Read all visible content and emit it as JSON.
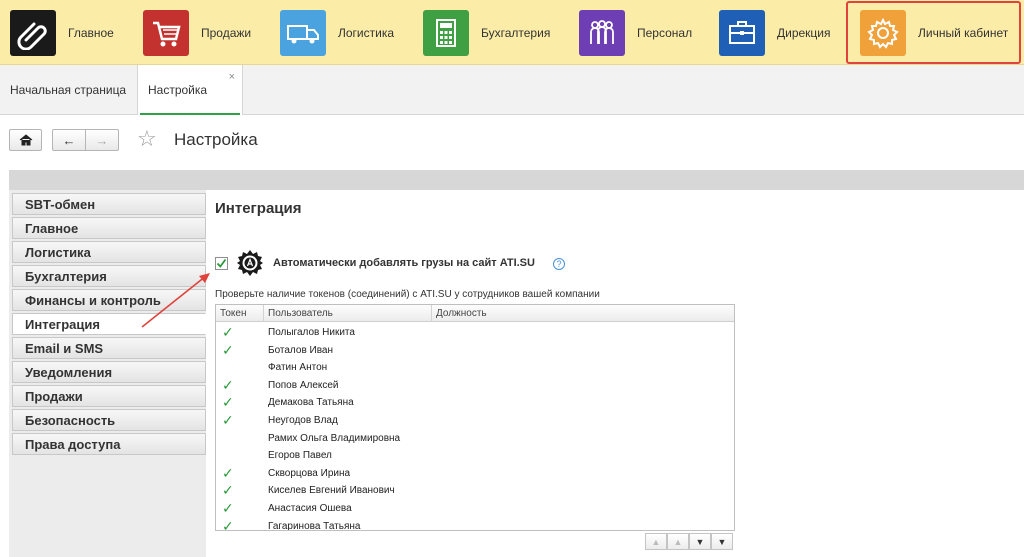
{
  "sections": [
    {
      "label": "Главное",
      "icon": "paperclip-icon",
      "color": "#1a1a1a"
    },
    {
      "label": "Продажи",
      "icon": "shopping-cart-icon",
      "color": "#c3322f"
    },
    {
      "label": "Логистика",
      "icon": "truck-icon",
      "color": "#4aa3df"
    },
    {
      "label": "Бухгалтерия",
      "icon": "calculator-icon",
      "color": "#3ea042"
    },
    {
      "label": "Персонал",
      "icon": "people-icon",
      "color": "#6e3fb4"
    },
    {
      "label": "Дирекция",
      "icon": "briefcase-icon",
      "color": "#1f5fb5"
    },
    {
      "label": "Личный кабинет",
      "icon": "gear-icon",
      "color": "#f0a13a"
    }
  ],
  "tabs": {
    "home": "Начальная страница",
    "current": "Настройка",
    "close": "×"
  },
  "page_title": "Настройка",
  "menu": [
    "SBT-обмен",
    "Главное",
    "Логистика",
    "Бухгалтерия",
    "Финансы и контроль",
    "Интеграция",
    "Email и SMS",
    "Уведомления",
    "Продажи",
    "Безопасность",
    "Права доступа"
  ],
  "active_menu": "Интеграция",
  "content": {
    "title": "Интеграция",
    "checkbox_label": "Автоматически добавлять грузы на сайт ATI.SU",
    "checkbox_checked": true,
    "help": "?",
    "hint": "Проверьте наличие токенов (соединений) с ATI.SU у сотрудников вашей компании"
  },
  "table": {
    "headers": [
      "Токен",
      "Пользователь",
      "Должность"
    ],
    "rows": [
      {
        "token": true,
        "user": "Полыгалов Никита"
      },
      {
        "token": true,
        "user": "Боталов Иван"
      },
      {
        "token": false,
        "user": "Фатин Антон"
      },
      {
        "token": true,
        "user": "Попов Алексей"
      },
      {
        "token": true,
        "user": "Демакова Татьяна"
      },
      {
        "token": true,
        "user": "Неугодов Влад"
      },
      {
        "token": false,
        "user": "Рамих Ольга Владимировна"
      },
      {
        "token": false,
        "user": "Егоров Павел"
      },
      {
        "token": true,
        "user": "Скворцова Ирина"
      },
      {
        "token": true,
        "user": "Киселев Евгений Иванович"
      },
      {
        "token": true,
        "user": "Анастасия Ошева"
      },
      {
        "token": true,
        "user": "Гагаринова Татьяна"
      }
    ]
  },
  "colors": {
    "topbar": "#fbeda8",
    "active_outline": "#e0423c",
    "tab_accent": "#2fa14a",
    "check": "#2b9a3c",
    "arrow": "#e0423c"
  }
}
